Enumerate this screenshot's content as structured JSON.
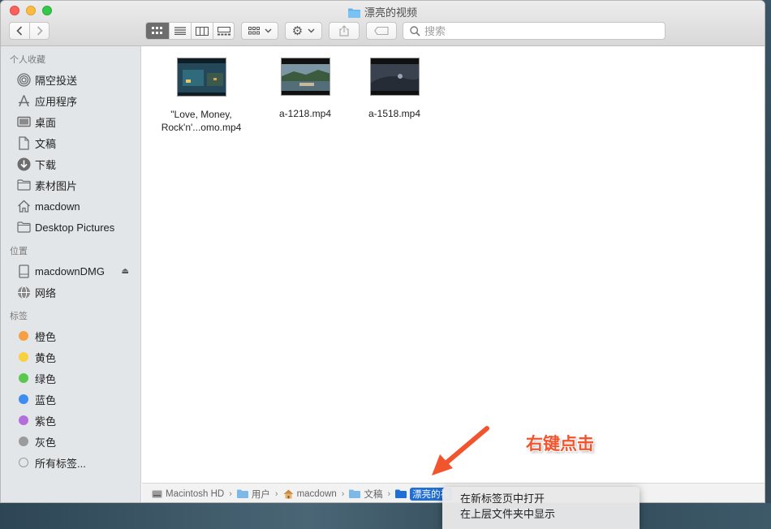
{
  "window": {
    "title": "漂亮的视频"
  },
  "toolbar": {
    "search_placeholder": "搜索",
    "view_modes": [
      "icon-view",
      "list-view",
      "column-view",
      "gallery-view"
    ]
  },
  "sidebar": {
    "favorites_header": "个人收藏",
    "favorites": [
      {
        "label": "隔空投送",
        "icon": "airdrop-icon"
      },
      {
        "label": "应用程序",
        "icon": "applications-icon"
      },
      {
        "label": "桌面",
        "icon": "desktop-icon"
      },
      {
        "label": "文稿",
        "icon": "documents-icon"
      },
      {
        "label": "下载",
        "icon": "downloads-icon"
      },
      {
        "label": "素材图片",
        "icon": "folder-icon"
      },
      {
        "label": "macdown",
        "icon": "home-icon"
      },
      {
        "label": "Desktop Pictures",
        "icon": "folder-icon"
      }
    ],
    "locations_header": "位置",
    "locations": [
      {
        "label": "macdownDMG",
        "icon": "disk-icon"
      },
      {
        "label": "网络",
        "icon": "network-icon"
      }
    ],
    "tags_header": "标签",
    "tags": [
      {
        "label": "橙色",
        "color": "#f6a042"
      },
      {
        "label": "黄色",
        "color": "#f7d13e"
      },
      {
        "label": "绿色",
        "color": "#5ac84d"
      },
      {
        "label": "蓝色",
        "color": "#3d8ef0"
      },
      {
        "label": "紫色",
        "color": "#b46ddb"
      },
      {
        "label": "灰色",
        "color": "#9b9b9b"
      }
    ],
    "all_tags": "所有标签..."
  },
  "files": [
    {
      "name_line1": "\"Love, Money,",
      "name_line2": "Rock'n'...omo.mp4"
    },
    {
      "name_line1": "a-1218.mp4",
      "name_line2": ""
    },
    {
      "name_line1": "a-1518.mp4",
      "name_line2": ""
    }
  ],
  "pathbar": {
    "crumbs": [
      "Macintosh HD",
      "用户",
      "macdown",
      "文稿",
      "漂亮的视"
    ]
  },
  "context_menu": {
    "items": [
      "在新标签页中打开",
      "在上层文件夹中显示"
    ]
  },
  "annotation": {
    "text": "右键点击",
    "color": "#f2542d"
  }
}
